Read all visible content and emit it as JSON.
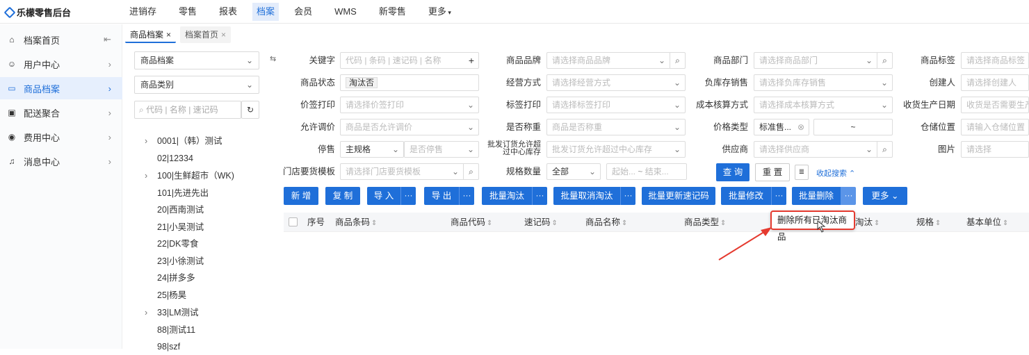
{
  "app": {
    "title": "乐檬零售后台"
  },
  "topnav": [
    "进销存",
    "零售",
    "报表",
    "档案",
    "会员",
    "WMS",
    "新零售",
    "更多"
  ],
  "topnav_active_index": 3,
  "sidebar": {
    "items": [
      {
        "label": "档案首页",
        "icon": "home-icon"
      },
      {
        "label": "用户中心",
        "icon": "user-icon"
      },
      {
        "label": "商品档案",
        "icon": "product-icon"
      },
      {
        "label": "配送聚合",
        "icon": "delivery-icon"
      },
      {
        "label": "费用中心",
        "icon": "fee-icon"
      },
      {
        "label": "消息中心",
        "icon": "bell-icon"
      }
    ],
    "active_index": 2
  },
  "tabs": [
    {
      "label": "商品档案"
    },
    {
      "label": "档案首页"
    }
  ],
  "tree": {
    "select1": "商品档案",
    "select2": "商品类别",
    "search_placeholder": "代码 | 名称 | 速记码",
    "nodes": [
      "0001|（韩）测试",
      "02|12334",
      "100|生鲜超市（WK)",
      "101|先进先出",
      "20|西南测试",
      "21|小吴测试",
      "22|DK零食",
      "23|小徐测试",
      "24|拼多多",
      "25|杨昊",
      "33|LM测试",
      "88|测试11",
      "98|szf"
    ]
  },
  "filters": {
    "keyword": {
      "label": "关键字",
      "placeholder": "代码 | 条码 | 速记码 | 名称"
    },
    "status": {
      "label": "商品状态",
      "value": "淘汰否"
    },
    "price_print": {
      "label": "价签打印",
      "placeholder": "请选择价签打印"
    },
    "allow_price": {
      "label": "允许调价",
      "placeholder": "商品是否允许调价"
    },
    "stop": {
      "label": "停售",
      "value": "主规格",
      "placeholder": "是否停售"
    },
    "template": {
      "label": "门店要货模板",
      "placeholder": "请选择门店要货模板"
    },
    "brand": {
      "label": "商品品牌",
      "placeholder": "请选择商品品牌"
    },
    "manage": {
      "label": "经营方式",
      "placeholder": "请选择经营方式"
    },
    "tag_print": {
      "label": "标签打印",
      "placeholder": "请选择标签打印"
    },
    "weigh": {
      "label": "是否称重",
      "placeholder": "商品是否称重"
    },
    "exceed": {
      "label": "批发订货允许超过中心库存",
      "placeholder": "批发订货允许超过中心库存"
    },
    "spec_count": {
      "label": "规格数量",
      "value": "全部",
      "from": "起始...",
      "to": "结束..."
    },
    "dept": {
      "label": "商品部门",
      "placeholder": "请选择商品部门"
    },
    "neg_stock": {
      "label": "负库存销售",
      "placeholder": "请选择负库存销售"
    },
    "cost": {
      "label": "成本核算方式",
      "placeholder": "请选择成本核算方式"
    },
    "price_type": {
      "label": "价格类型",
      "value": "标准售...",
      "range_sep": "~"
    },
    "supplier": {
      "label": "供应商",
      "placeholder": "请选择供应商"
    },
    "tag": {
      "label": "商品标签",
      "placeholder": "请选择商品标签"
    },
    "creator": {
      "label": "创建人",
      "placeholder": "请选择创建人"
    },
    "prod_date": {
      "label": "收货生产日期",
      "placeholder": "收货是否需要生产"
    },
    "location": {
      "label": "仓储位置",
      "placeholder": "请输入仓储位置"
    },
    "image": {
      "label": "图片",
      "placeholder": "请选择"
    }
  },
  "search_buttons": {
    "query": "查 询",
    "reset": "重 置",
    "collapse": "收起搜索"
  },
  "actions": [
    "新 增",
    "复 制",
    "导 入",
    "导 出",
    "批量淘汰",
    "批量取消淘汰",
    "批量更新速记码",
    "批量修改",
    "批量删除",
    "更多"
  ],
  "table": {
    "columns": [
      "序号",
      "商品条码",
      "商品代码",
      "速记码",
      "商品名称",
      "商品类型",
      "淘汰",
      "规格",
      "基本单位"
    ]
  },
  "popover": {
    "label": "删除所有已淘汰商品"
  },
  "colors": {
    "primary": "#1f6fd9",
    "highlight": "#e53a2f"
  }
}
